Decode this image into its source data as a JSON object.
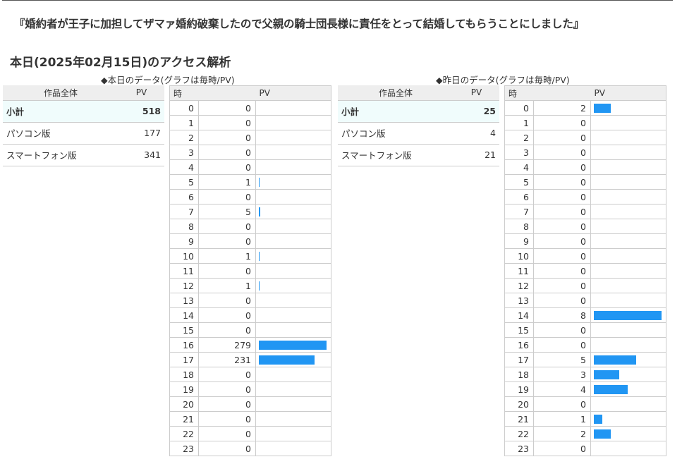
{
  "novel_title": "『婚約者が王子に加担してザマァ婚約破棄したので父親の騎士団長様に責任をとって結婚してもらうことにしました』",
  "page_heading": "本日(2025年02月15日)のアクセス解析",
  "colors": {
    "bar": "#2196f3",
    "header_bg": "#eeeeee",
    "subtotal_bg": "#f0fcfc"
  },
  "today": {
    "caption": "◆本日のデータ(グラフは毎時/PV)",
    "summary": {
      "headers": [
        "作品全体",
        "PV"
      ],
      "rows": [
        {
          "label": "小計",
          "value": "518"
        },
        {
          "label": "パソコン版",
          "value": "177"
        },
        {
          "label": "スマートフォン版",
          "value": "341"
        }
      ]
    },
    "hourly": {
      "headers": [
        "時",
        "PV"
      ],
      "rows": [
        {
          "hour": "0",
          "pv": "0"
        },
        {
          "hour": "1",
          "pv": "0"
        },
        {
          "hour": "2",
          "pv": "0"
        },
        {
          "hour": "3",
          "pv": "0"
        },
        {
          "hour": "4",
          "pv": "0"
        },
        {
          "hour": "5",
          "pv": "1"
        },
        {
          "hour": "6",
          "pv": "0"
        },
        {
          "hour": "7",
          "pv": "5"
        },
        {
          "hour": "8",
          "pv": "0"
        },
        {
          "hour": "9",
          "pv": "0"
        },
        {
          "hour": "10",
          "pv": "1"
        },
        {
          "hour": "11",
          "pv": "0"
        },
        {
          "hour": "12",
          "pv": "1"
        },
        {
          "hour": "13",
          "pv": "0"
        },
        {
          "hour": "14",
          "pv": "0"
        },
        {
          "hour": "15",
          "pv": "0"
        },
        {
          "hour": "16",
          "pv": "279"
        },
        {
          "hour": "17",
          "pv": "231"
        },
        {
          "hour": "18",
          "pv": "0"
        },
        {
          "hour": "19",
          "pv": "0"
        },
        {
          "hour": "20",
          "pv": "0"
        },
        {
          "hour": "21",
          "pv": "0"
        },
        {
          "hour": "22",
          "pv": "0"
        },
        {
          "hour": "23",
          "pv": "0"
        }
      ]
    }
  },
  "yesterday": {
    "caption": "◆昨日のデータ(グラフは毎時/PV)",
    "summary": {
      "headers": [
        "作品全体",
        "PV"
      ],
      "rows": [
        {
          "label": "小計",
          "value": "25"
        },
        {
          "label": "パソコン版",
          "value": "4"
        },
        {
          "label": "スマートフォン版",
          "value": "21"
        }
      ]
    },
    "hourly": {
      "headers": [
        "時",
        "PV"
      ],
      "rows": [
        {
          "hour": "0",
          "pv": "2"
        },
        {
          "hour": "1",
          "pv": "0"
        },
        {
          "hour": "2",
          "pv": "0"
        },
        {
          "hour": "3",
          "pv": "0"
        },
        {
          "hour": "4",
          "pv": "0"
        },
        {
          "hour": "5",
          "pv": "0"
        },
        {
          "hour": "6",
          "pv": "0"
        },
        {
          "hour": "7",
          "pv": "0"
        },
        {
          "hour": "8",
          "pv": "0"
        },
        {
          "hour": "9",
          "pv": "0"
        },
        {
          "hour": "10",
          "pv": "0"
        },
        {
          "hour": "11",
          "pv": "0"
        },
        {
          "hour": "12",
          "pv": "0"
        },
        {
          "hour": "13",
          "pv": "0"
        },
        {
          "hour": "14",
          "pv": "8"
        },
        {
          "hour": "15",
          "pv": "0"
        },
        {
          "hour": "16",
          "pv": "0"
        },
        {
          "hour": "17",
          "pv": "5"
        },
        {
          "hour": "18",
          "pv": "3"
        },
        {
          "hour": "19",
          "pv": "4"
        },
        {
          "hour": "20",
          "pv": "0"
        },
        {
          "hour": "21",
          "pv": "1"
        },
        {
          "hour": "22",
          "pv": "2"
        },
        {
          "hour": "23",
          "pv": "0"
        }
      ]
    }
  }
}
